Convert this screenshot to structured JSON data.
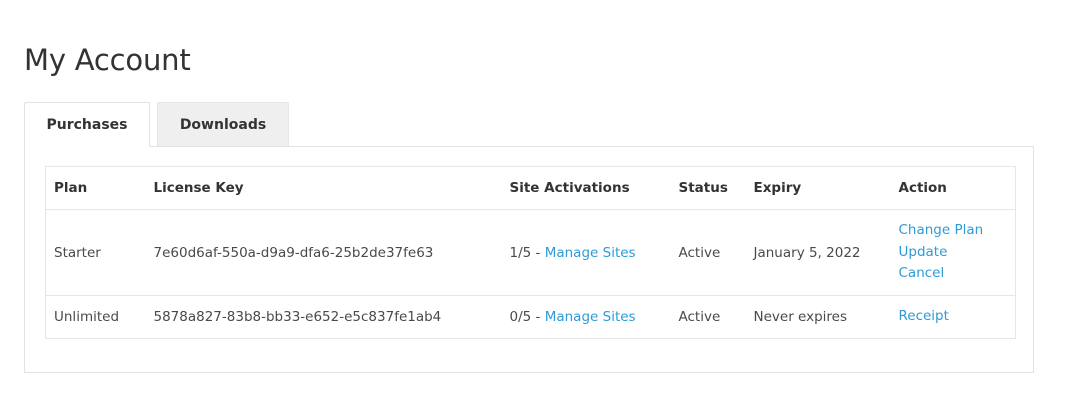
{
  "page": {
    "title": "My Account"
  },
  "tabs": [
    {
      "label": "Purchases",
      "active": true
    },
    {
      "label": "Downloads",
      "active": false
    }
  ],
  "table": {
    "columns": [
      "Plan",
      "License Key",
      "Site Activations",
      "Status",
      "Expiry",
      "Action"
    ],
    "rows": [
      {
        "plan": "Starter",
        "license_key": "7e60d6af-550a-d9a9-dfa6-25b2de37fe63",
        "activations_count": "1/5",
        "activations_sep": " - ",
        "manage_sites_label": "Manage Sites",
        "status": "Active",
        "expiry": "January 5, 2022",
        "actions": [
          "Change Plan",
          "Update",
          "Cancel"
        ]
      },
      {
        "plan": "Unlimited",
        "license_key": "5878a827-83b8-bb33-e652-e5c837fe1ab4",
        "activations_count": "0/5",
        "activations_sep": " - ",
        "manage_sites_label": "Manage Sites",
        "status": "Active",
        "expiry": "Never expires",
        "actions": [
          "Receipt"
        ]
      }
    ]
  },
  "colors": {
    "link": "#2e9bd6",
    "border": "#e2e2e2",
    "inactive_tab_bg": "#efefef"
  }
}
